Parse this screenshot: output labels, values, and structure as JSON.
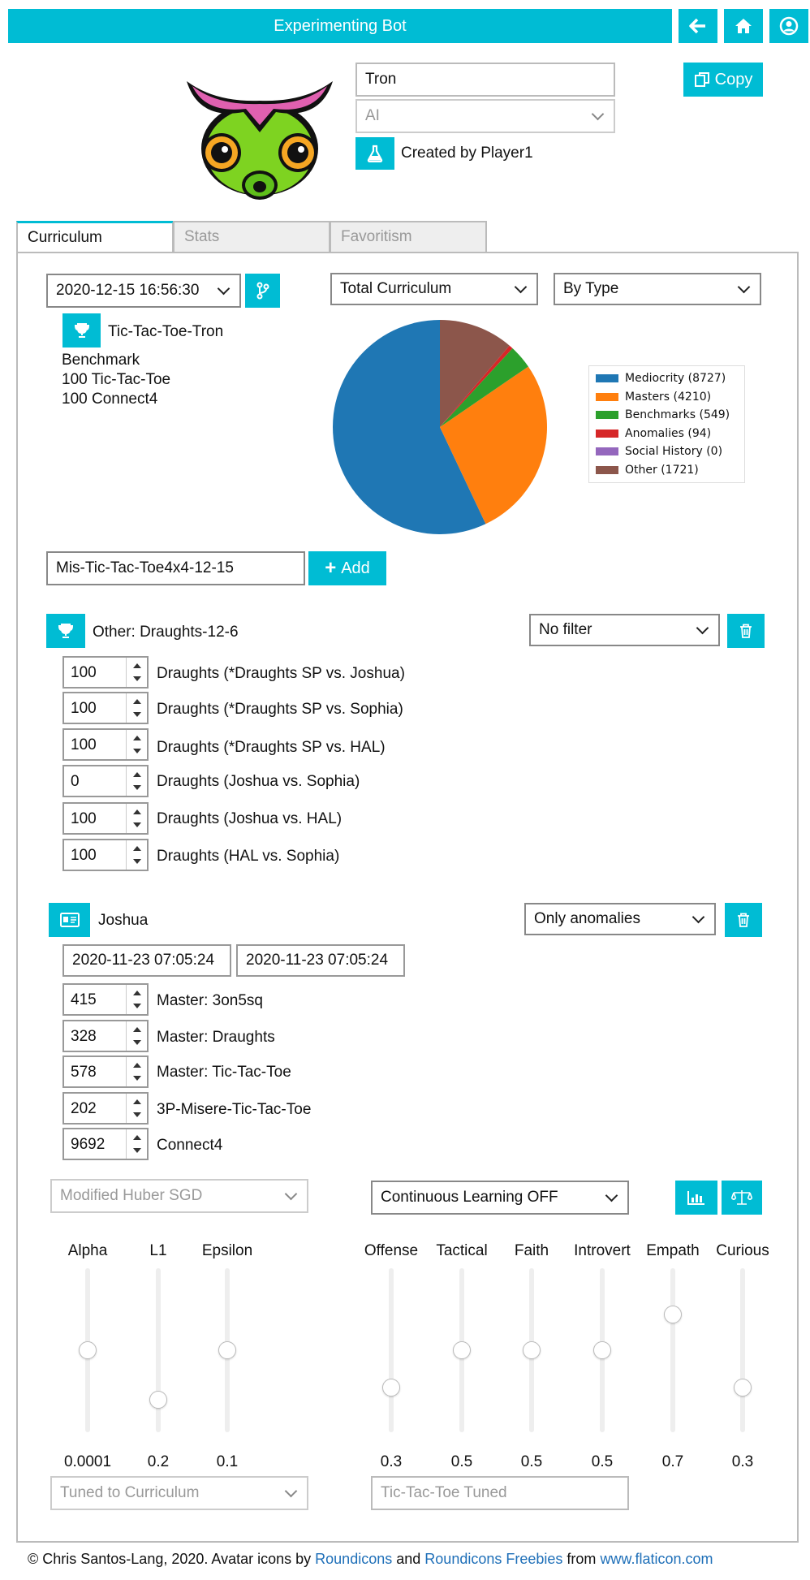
{
  "header": {
    "title": "Experimenting Bot"
  },
  "bot": {
    "name": "Tron",
    "kind": "AI",
    "created_by": "Created by Player1",
    "copy_label": "Copy"
  },
  "tabs": [
    {
      "label": "Curriculum",
      "active": true
    },
    {
      "label": "Stats",
      "active": false
    },
    {
      "label": "Favoritism",
      "active": false
    }
  ],
  "curriculum": {
    "timestamp": "2020-12-15 16:56:30",
    "champion": "Tic-Tac-Toe-Tron",
    "entries": [
      "Benchmark",
      "100 Tic-Tac-Toe",
      "100 Connect4"
    ],
    "view_select": "Total Curriculum",
    "group_select": "By Type",
    "new_item_value": "Mis-Tic-Tac-Toe4x4-12-15",
    "add_label": "Add"
  },
  "chart_data": {
    "type": "pie",
    "labels": [
      "Mediocrity",
      "Masters",
      "Benchmarks",
      "Anomalies",
      "Social History",
      "Other"
    ],
    "values": [
      8727,
      4210,
      549,
      94,
      0,
      1721
    ],
    "legend": [
      "Mediocrity (8727)",
      "Masters (4210)",
      "Benchmarks (549)",
      "Anomalies (94)",
      "Social History (0)",
      "Other (1721)"
    ],
    "colors": [
      "#1f77b4",
      "#ff7f0e",
      "#2ca02c",
      "#d62728",
      "#9467bd",
      "#8c564b"
    ],
    "legend_position": "right"
  },
  "other_section": {
    "title": "Other: Draughts-12-6",
    "filter": "No filter",
    "rows": [
      {
        "value": "100",
        "label": "Draughts (*Draughts SP vs. Joshua)"
      },
      {
        "value": "100",
        "label": "Draughts (*Draughts SP vs. Sophia)"
      },
      {
        "value": "100",
        "label": "Draughts (*Draughts SP vs. HAL)"
      },
      {
        "value": "0",
        "label": "Draughts (Joshua vs. Sophia)"
      },
      {
        "value": "100",
        "label": "Draughts (Joshua vs. HAL)"
      },
      {
        "value": "100",
        "label": "Draughts (HAL vs. Sophia)"
      }
    ]
  },
  "joshua_section": {
    "title": "Joshua",
    "filter": "Only anomalies",
    "date_from": "2020-11-23 07:05:24",
    "date_to": "2020-11-23 07:05:24",
    "rows": [
      {
        "value": "415",
        "label": "Master: 3on5sq"
      },
      {
        "value": "328",
        "label": "Master: Draughts"
      },
      {
        "value": "578",
        "label": "Master: Tic-Tac-Toe"
      },
      {
        "value": "202",
        "label": "3P-Misere-Tic-Tac-Toe"
      },
      {
        "value": "9692",
        "label": "Connect4"
      }
    ]
  },
  "learning": {
    "algorithm": "Modified Huber SGD",
    "continuous": "Continuous Learning OFF",
    "tuning": "Tuned to Curriculum",
    "tuned_text": "Tic-Tac-Toe Tuned",
    "left_sliders": [
      {
        "label": "Alpha",
        "value": "0.0001",
        "level": 0.5
      },
      {
        "label": "L1",
        "value": "0.2",
        "level": 0.2
      },
      {
        "label": "Epsilon",
        "value": "0.1",
        "level": 0.5
      }
    ],
    "right_sliders": [
      {
        "label": "Offense",
        "value": "0.3",
        "level": 0.27
      },
      {
        "label": "Tactical",
        "value": "0.5",
        "level": 0.5
      },
      {
        "label": "Faith",
        "value": "0.5",
        "level": 0.5
      },
      {
        "label": "Introvert",
        "value": "0.5",
        "level": 0.5
      },
      {
        "label": "Empath",
        "value": "0.7",
        "level": 0.72
      },
      {
        "label": "Curious",
        "value": "0.3",
        "level": 0.27
      }
    ]
  },
  "footer": {
    "prefix": "© Chris Santos-Lang, 2020. Avatar icons by",
    "link1": "Roundicons",
    "and": "and",
    "link2": "Roundicons Freebies",
    "from": "from",
    "link3": "www.flaticon.com"
  }
}
